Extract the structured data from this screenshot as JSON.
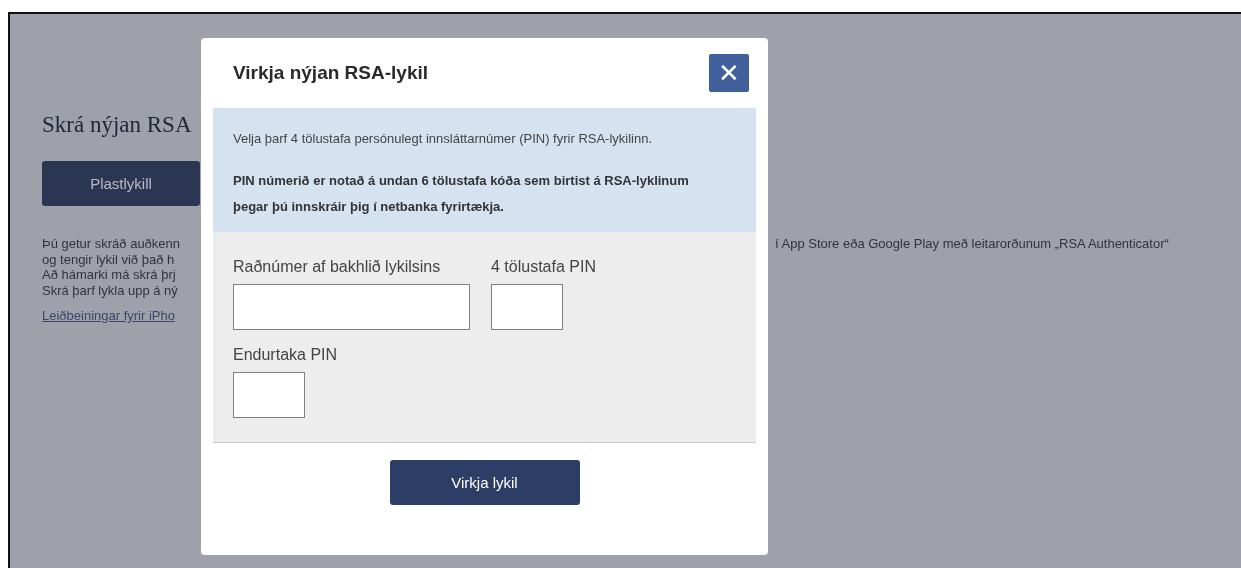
{
  "page": {
    "heading": "Skrá nýjan RSA",
    "button": "Plastlykill",
    "paragraph_lines": [
      "Þú getur skráð auðkenn",
      "og tengir lykil við það h",
      "Að hámarki má skrá þrj",
      "Skrá þarf lykla upp á ný"
    ],
    "paragraph_right": "í App Store eða Google Play með leitarorðunum „RSA Authenticator“",
    "link": "Leiðbeiningar fyrir iPho"
  },
  "dialog": {
    "title": "Virkja nýjan RSA-lykil",
    "close": "✕",
    "info": [
      "Velja þarf 4 tölustafa persónulegt innsláttarnúmer (PIN) fyrir RSA-lykilinn.",
      "PIN númerið er notað á undan 6 tölustafa kóða sem birtist á RSA-lyklinum þegar þú innskráir þig í netbanka fyrirtækja."
    ],
    "fields": [
      {
        "label": "Raðnúmer af bakhlið lykilsins",
        "kind": "wide"
      },
      {
        "label": "4 tölustafa PIN",
        "kind": "short"
      },
      {
        "label": "Endurtaka PIN",
        "kind": "short"
      }
    ],
    "submit": "Virkja lykil"
  }
}
